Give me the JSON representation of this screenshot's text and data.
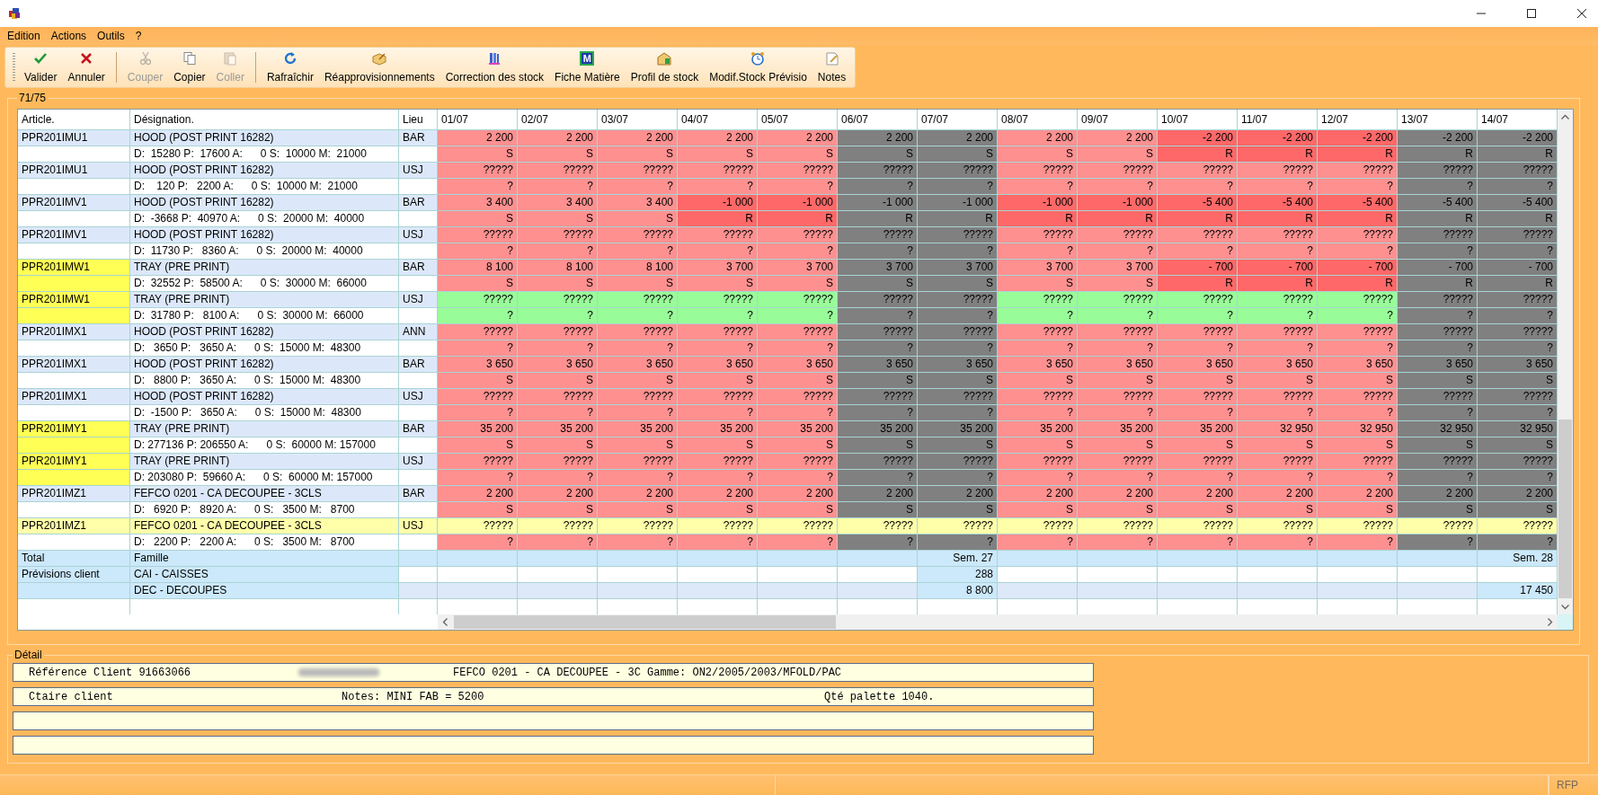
{
  "menu": [
    "Edition",
    "Actions",
    "Outils",
    "?"
  ],
  "toolbar": {
    "groups": [
      {
        "buttons": [
          {
            "label": "Valider",
            "disabled": false
          },
          {
            "label": "Annuler",
            "disabled": false
          }
        ]
      },
      {
        "buttons": [
          {
            "label": "Couper",
            "disabled": true
          },
          {
            "label": "Copier",
            "disabled": false
          },
          {
            "label": "Coller",
            "disabled": true
          }
        ]
      },
      {
        "buttons": [
          {
            "label": "Rafraîchir",
            "disabled": false
          },
          {
            "label": "Réapprovisionnements",
            "disabled": false
          },
          {
            "label": "Correction des stock",
            "disabled": false
          },
          {
            "label": "Fiche Matière",
            "disabled": false,
            "icon_text": "M"
          },
          {
            "label": "Profil de stock",
            "disabled": false
          },
          {
            "label": "Modif.Stock Prévisio",
            "disabled": false
          },
          {
            "label": "Notes",
            "disabled": false
          }
        ]
      }
    ]
  },
  "group_title": "71/75",
  "table": {
    "columns": [
      "Article.",
      "Désignation.",
      "Lieu",
      "01/07",
      "02/07",
      "03/07",
      "04/07",
      "05/07",
      "06/07",
      "07/07",
      "08/07",
      "09/07",
      "10/07",
      "11/07",
      "12/07",
      "13/07",
      "14/07"
    ],
    "rows": [
      {
        "article": "PPR201IMU1",
        "designation": "HOOD (POST PRINT 16282)",
        "lieu": "BAR",
        "flagged": false,
        "selected": false,
        "detail": "D:  15280 P:  17600 A:      0 S:  10000 M:  21000",
        "cells": [
          {
            "text": "2 200",
            "color": "#ff9090"
          },
          {
            "text": "2 200",
            "color": "#ff9090"
          },
          {
            "text": "2 200",
            "color": "#ff9090"
          },
          {
            "text": "2 200",
            "color": "#ff9090"
          },
          {
            "text": "2 200",
            "color": "#ff9090"
          },
          {
            "text": "2 200",
            "color": "#808080"
          },
          {
            "text": "2 200",
            "color": "#808080"
          },
          {
            "text": "2 200",
            "color": "#ff9090"
          },
          {
            "text": "2 200",
            "color": "#ff9090"
          },
          {
            "text": "-2 200",
            "color": "#ff6868"
          },
          {
            "text": "-2 200",
            "color": "#ff6868"
          },
          {
            "text": "-2 200",
            "color": "#ff6868"
          },
          {
            "text": "-2 200",
            "color": "#808080"
          },
          {
            "text": "-2 200",
            "color": "#808080"
          }
        ],
        "detail_cells": [
          {
            "text": "S",
            "color": "#ff9090"
          },
          {
            "text": "S",
            "color": "#ff9090"
          },
          {
            "text": "S",
            "color": "#ff9090"
          },
          {
            "text": "S",
            "color": "#ff9090"
          },
          {
            "text": "S",
            "color": "#ff9090"
          },
          {
            "text": "S",
            "color": "#808080"
          },
          {
            "text": "S",
            "color": "#808080"
          },
          {
            "text": "S",
            "color": "#ff9090"
          },
          {
            "text": "S",
            "color": "#ff9090"
          },
          {
            "text": "R",
            "color": "#ff6868"
          },
          {
            "text": "R",
            "color": "#ff6868"
          },
          {
            "text": "R",
            "color": "#ff6868"
          },
          {
            "text": "R",
            "color": "#808080"
          },
          {
            "text": "R",
            "color": "#808080"
          }
        ]
      },
      {
        "article": "PPR201IMU1",
        "designation": "HOOD (POST PRINT 16282)",
        "lieu": "USJ",
        "flagged": false,
        "selected": false,
        "detail": "D:    120 P:   2200 A:      0 S:  10000 M:  21000",
        "cells": [
          {
            "text": "?????",
            "color": "#ff9090"
          },
          {
            "text": "?????",
            "color": "#ff9090"
          },
          {
            "text": "?????",
            "color": "#ff9090"
          },
          {
            "text": "?????",
            "color": "#ff9090"
          },
          {
            "text": "?????",
            "color": "#ff9090"
          },
          {
            "text": "?????",
            "color": "#808080"
          },
          {
            "text": "?????",
            "color": "#808080"
          },
          {
            "text": "?????",
            "color": "#ff9090"
          },
          {
            "text": "?????",
            "color": "#ff9090"
          },
          {
            "text": "?????",
            "color": "#ff9090"
          },
          {
            "text": "?????",
            "color": "#ff9090"
          },
          {
            "text": "?????",
            "color": "#ff9090"
          },
          {
            "text": "?????",
            "color": "#808080"
          },
          {
            "text": "?????",
            "color": "#808080"
          }
        ],
        "detail_cells": [
          {
            "text": "?",
            "color": "#ff9090"
          },
          {
            "text": "?",
            "color": "#ff9090"
          },
          {
            "text": "?",
            "color": "#ff9090"
          },
          {
            "text": "?",
            "color": "#ff9090"
          },
          {
            "text": "?",
            "color": "#ff9090"
          },
          {
            "text": "?",
            "color": "#808080"
          },
          {
            "text": "?",
            "color": "#808080"
          },
          {
            "text": "?",
            "color": "#ff9090"
          },
          {
            "text": "?",
            "color": "#ff9090"
          },
          {
            "text": "?",
            "color": "#ff9090"
          },
          {
            "text": "?",
            "color": "#ff9090"
          },
          {
            "text": "?",
            "color": "#ff9090"
          },
          {
            "text": "?",
            "color": "#808080"
          },
          {
            "text": "?",
            "color": "#808080"
          }
        ]
      },
      {
        "article": "PPR201IMV1",
        "designation": "HOOD (POST PRINT 16282)",
        "lieu": "BAR",
        "flagged": false,
        "selected": false,
        "detail": "D:  -3668 P:  40970 A:      0 S:  20000 M:  40000",
        "cells": [
          {
            "text": "3 400",
            "color": "#ff9090"
          },
          {
            "text": "3 400",
            "color": "#ff9090"
          },
          {
            "text": "3 400",
            "color": "#ff9090"
          },
          {
            "text": "-1 000",
            "color": "#ff6868"
          },
          {
            "text": "-1 000",
            "color": "#ff6868"
          },
          {
            "text": "-1 000",
            "color": "#808080"
          },
          {
            "text": "-1 000",
            "color": "#808080"
          },
          {
            "text": "-1 000",
            "color": "#ff6868"
          },
          {
            "text": "-1 000",
            "color": "#ff6868"
          },
          {
            "text": "-5 400",
            "color": "#ff6868"
          },
          {
            "text": "-5 400",
            "color": "#ff6868"
          },
          {
            "text": "-5 400",
            "color": "#ff6868"
          },
          {
            "text": "-5 400",
            "color": "#808080"
          },
          {
            "text": "-5 400",
            "color": "#808080"
          }
        ],
        "detail_cells": [
          {
            "text": "S",
            "color": "#ff9090"
          },
          {
            "text": "S",
            "color": "#ff9090"
          },
          {
            "text": "S",
            "color": "#ff9090"
          },
          {
            "text": "R",
            "color": "#ff6868"
          },
          {
            "text": "R",
            "color": "#ff6868"
          },
          {
            "text": "R",
            "color": "#808080"
          },
          {
            "text": "R",
            "color": "#808080"
          },
          {
            "text": "R",
            "color": "#ff6868"
          },
          {
            "text": "R",
            "color": "#ff6868"
          },
          {
            "text": "R",
            "color": "#ff6868"
          },
          {
            "text": "R",
            "color": "#ff6868"
          },
          {
            "text": "R",
            "color": "#ff6868"
          },
          {
            "text": "R",
            "color": "#808080"
          },
          {
            "text": "R",
            "color": "#808080"
          }
        ]
      },
      {
        "article": "PPR201IMV1",
        "designation": "HOOD (POST PRINT 16282)",
        "lieu": "USJ",
        "flagged": false,
        "selected": false,
        "detail": "D:  11730 P:   8360 A:      0 S:  20000 M:  40000",
        "cells": [
          {
            "text": "?????",
            "color": "#ff9090"
          },
          {
            "text": "?????",
            "color": "#ff9090"
          },
          {
            "text": "?????",
            "color": "#ff9090"
          },
          {
            "text": "?????",
            "color": "#ff9090"
          },
          {
            "text": "?????",
            "color": "#ff9090"
          },
          {
            "text": "?????",
            "color": "#808080"
          },
          {
            "text": "?????",
            "color": "#808080"
          },
          {
            "text": "?????",
            "color": "#ff9090"
          },
          {
            "text": "?????",
            "color": "#ff9090"
          },
          {
            "text": "?????",
            "color": "#ff9090"
          },
          {
            "text": "?????",
            "color": "#ff9090"
          },
          {
            "text": "?????",
            "color": "#ff9090"
          },
          {
            "text": "?????",
            "color": "#808080"
          },
          {
            "text": "?????",
            "color": "#808080"
          }
        ],
        "detail_cells": [
          {
            "text": "?",
            "color": "#ff9090"
          },
          {
            "text": "?",
            "color": "#ff9090"
          },
          {
            "text": "?",
            "color": "#ff9090"
          },
          {
            "text": "?",
            "color": "#ff9090"
          },
          {
            "text": "?",
            "color": "#ff9090"
          },
          {
            "text": "?",
            "color": "#808080"
          },
          {
            "text": "?",
            "color": "#808080"
          },
          {
            "text": "?",
            "color": "#ff9090"
          },
          {
            "text": "?",
            "color": "#ff9090"
          },
          {
            "text": "?",
            "color": "#ff9090"
          },
          {
            "text": "?",
            "color": "#ff9090"
          },
          {
            "text": "?",
            "color": "#ff9090"
          },
          {
            "text": "?",
            "color": "#808080"
          },
          {
            "text": "?",
            "color": "#808080"
          }
        ]
      },
      {
        "article": "PPR201IMW1",
        "designation": "TRAY (PRE PRINT)",
        "lieu": "BAR",
        "flagged": true,
        "selected": false,
        "detail": "D:  32552 P:  58500 A:      0 S:  30000 M:  66000",
        "cells": [
          {
            "text": "8 100",
            "color": "#ff9090"
          },
          {
            "text": "8 100",
            "color": "#ff9090"
          },
          {
            "text": "8 100",
            "color": "#ff9090"
          },
          {
            "text": "3 700",
            "color": "#ff9090"
          },
          {
            "text": "3 700",
            "color": "#ff9090"
          },
          {
            "text": "3 700",
            "color": "#808080"
          },
          {
            "text": "3 700",
            "color": "#808080"
          },
          {
            "text": "3 700",
            "color": "#ff9090"
          },
          {
            "text": "3 700",
            "color": "#ff9090"
          },
          {
            "text": "- 700",
            "color": "#ff6868"
          },
          {
            "text": "- 700",
            "color": "#ff6868"
          },
          {
            "text": "- 700",
            "color": "#ff6868"
          },
          {
            "text": "- 700",
            "color": "#808080"
          },
          {
            "text": "- 700",
            "color": "#808080"
          }
        ],
        "detail_cells": [
          {
            "text": "S",
            "color": "#ff9090"
          },
          {
            "text": "S",
            "color": "#ff9090"
          },
          {
            "text": "S",
            "color": "#ff9090"
          },
          {
            "text": "S",
            "color": "#ff9090"
          },
          {
            "text": "S",
            "color": "#ff9090"
          },
          {
            "text": "S",
            "color": "#808080"
          },
          {
            "text": "S",
            "color": "#808080"
          },
          {
            "text": "S",
            "color": "#ff9090"
          },
          {
            "text": "S",
            "color": "#ff9090"
          },
          {
            "text": "R",
            "color": "#ff6868"
          },
          {
            "text": "R",
            "color": "#ff6868"
          },
          {
            "text": "R",
            "color": "#ff6868"
          },
          {
            "text": "R",
            "color": "#808080"
          },
          {
            "text": "R",
            "color": "#808080"
          }
        ]
      },
      {
        "article": "PPR201IMW1",
        "designation": "TRAY (PRE PRINT)",
        "lieu": "USJ",
        "flagged": true,
        "selected": false,
        "detail": "D:  31780 P:   8100 A:      0 S:  30000 M:  66000",
        "cells": [
          {
            "text": "?????",
            "color": "#98fc98"
          },
          {
            "text": "?????",
            "color": "#98fc98"
          },
          {
            "text": "?????",
            "color": "#98fc98"
          },
          {
            "text": "?????",
            "color": "#98fc98"
          },
          {
            "text": "?????",
            "color": "#98fc98"
          },
          {
            "text": "?????",
            "color": "#808080"
          },
          {
            "text": "?????",
            "color": "#808080"
          },
          {
            "text": "?????",
            "color": "#98fc98"
          },
          {
            "text": "?????",
            "color": "#98fc98"
          },
          {
            "text": "?????",
            "color": "#98fc98"
          },
          {
            "text": "?????",
            "color": "#98fc98"
          },
          {
            "text": "?????",
            "color": "#98fc98"
          },
          {
            "text": "?????",
            "color": "#808080"
          },
          {
            "text": "?????",
            "color": "#808080"
          }
        ],
        "detail_cells": [
          {
            "text": "?",
            "color": "#98fc98"
          },
          {
            "text": "?",
            "color": "#98fc98"
          },
          {
            "text": "?",
            "color": "#98fc98"
          },
          {
            "text": "?",
            "color": "#98fc98"
          },
          {
            "text": "?",
            "color": "#98fc98"
          },
          {
            "text": "?",
            "color": "#808080"
          },
          {
            "text": "?",
            "color": "#808080"
          },
          {
            "text": "?",
            "color": "#98fc98"
          },
          {
            "text": "?",
            "color": "#98fc98"
          },
          {
            "text": "?",
            "color": "#98fc98"
          },
          {
            "text": "?",
            "color": "#98fc98"
          },
          {
            "text": "?",
            "color": "#98fc98"
          },
          {
            "text": "?",
            "color": "#808080"
          },
          {
            "text": "?",
            "color": "#808080"
          }
        ]
      },
      {
        "article": "PPR201IMX1",
        "designation": "HOOD (POST PRINT 16282)",
        "lieu": "ANN",
        "flagged": false,
        "selected": false,
        "detail": "D:   3650 P:   3650 A:      0 S:  15000 M:  48300",
        "cells": [
          {
            "text": "?????",
            "color": "#ff9090"
          },
          {
            "text": "?????",
            "color": "#ff9090"
          },
          {
            "text": "?????",
            "color": "#ff9090"
          },
          {
            "text": "?????",
            "color": "#ff9090"
          },
          {
            "text": "?????",
            "color": "#ff9090"
          },
          {
            "text": "?????",
            "color": "#808080"
          },
          {
            "text": "?????",
            "color": "#808080"
          },
          {
            "text": "?????",
            "color": "#ff9090"
          },
          {
            "text": "?????",
            "color": "#ff9090"
          },
          {
            "text": "?????",
            "color": "#ff9090"
          },
          {
            "text": "?????",
            "color": "#ff9090"
          },
          {
            "text": "?????",
            "color": "#ff9090"
          },
          {
            "text": "?????",
            "color": "#808080"
          },
          {
            "text": "?????",
            "color": "#808080"
          }
        ],
        "detail_cells": [
          {
            "text": "?",
            "color": "#ff9090"
          },
          {
            "text": "?",
            "color": "#ff9090"
          },
          {
            "text": "?",
            "color": "#ff9090"
          },
          {
            "text": "?",
            "color": "#ff9090"
          },
          {
            "text": "?",
            "color": "#ff9090"
          },
          {
            "text": "?",
            "color": "#808080"
          },
          {
            "text": "?",
            "color": "#808080"
          },
          {
            "text": "?",
            "color": "#ff9090"
          },
          {
            "text": "?",
            "color": "#ff9090"
          },
          {
            "text": "?",
            "color": "#ff9090"
          },
          {
            "text": "?",
            "color": "#ff9090"
          },
          {
            "text": "?",
            "color": "#ff9090"
          },
          {
            "text": "?",
            "color": "#808080"
          },
          {
            "text": "?",
            "color": "#808080"
          }
        ]
      },
      {
        "article": "PPR201IMX1",
        "designation": "HOOD (POST PRINT 16282)",
        "lieu": "BAR",
        "flagged": false,
        "selected": false,
        "detail": "D:   8800 P:   3650 A:      0 S:  15000 M:  48300",
        "cells": [
          {
            "text": "3 650",
            "color": "#ff9090"
          },
          {
            "text": "3 650",
            "color": "#ff9090"
          },
          {
            "text": "3 650",
            "color": "#ff9090"
          },
          {
            "text": "3 650",
            "color": "#ff9090"
          },
          {
            "text": "3 650",
            "color": "#ff9090"
          },
          {
            "text": "3 650",
            "color": "#808080"
          },
          {
            "text": "3 650",
            "color": "#808080"
          },
          {
            "text": "3 650",
            "color": "#ff9090"
          },
          {
            "text": "3 650",
            "color": "#ff9090"
          },
          {
            "text": "3 650",
            "color": "#ff9090"
          },
          {
            "text": "3 650",
            "color": "#ff9090"
          },
          {
            "text": "3 650",
            "color": "#ff9090"
          },
          {
            "text": "3 650",
            "color": "#808080"
          },
          {
            "text": "3 650",
            "color": "#808080"
          }
        ],
        "detail_cells": [
          {
            "text": "S",
            "color": "#ff9090"
          },
          {
            "text": "S",
            "color": "#ff9090"
          },
          {
            "text": "S",
            "color": "#ff9090"
          },
          {
            "text": "S",
            "color": "#ff9090"
          },
          {
            "text": "S",
            "color": "#ff9090"
          },
          {
            "text": "S",
            "color": "#808080"
          },
          {
            "text": "S",
            "color": "#808080"
          },
          {
            "text": "S",
            "color": "#ff9090"
          },
          {
            "text": "S",
            "color": "#ff9090"
          },
          {
            "text": "S",
            "color": "#ff9090"
          },
          {
            "text": "S",
            "color": "#ff9090"
          },
          {
            "text": "S",
            "color": "#ff9090"
          },
          {
            "text": "S",
            "color": "#808080"
          },
          {
            "text": "S",
            "color": "#808080"
          }
        ]
      },
      {
        "article": "PPR201IMX1",
        "designation": "HOOD (POST PRINT 16282)",
        "lieu": "USJ",
        "flagged": false,
        "selected": false,
        "detail": "D:  -1500 P:   3650 A:      0 S:  15000 M:  48300",
        "cells": [
          {
            "text": "?????",
            "color": "#ff9090"
          },
          {
            "text": "?????",
            "color": "#ff9090"
          },
          {
            "text": "?????",
            "color": "#ff9090"
          },
          {
            "text": "?????",
            "color": "#ff9090"
          },
          {
            "text": "?????",
            "color": "#ff9090"
          },
          {
            "text": "?????",
            "color": "#808080"
          },
          {
            "text": "?????",
            "color": "#808080"
          },
          {
            "text": "?????",
            "color": "#ff9090"
          },
          {
            "text": "?????",
            "color": "#ff9090"
          },
          {
            "text": "?????",
            "color": "#ff9090"
          },
          {
            "text": "?????",
            "color": "#ff9090"
          },
          {
            "text": "?????",
            "color": "#ff9090"
          },
          {
            "text": "?????",
            "color": "#808080"
          },
          {
            "text": "?????",
            "color": "#808080"
          }
        ],
        "detail_cells": [
          {
            "text": "?",
            "color": "#ff9090"
          },
          {
            "text": "?",
            "color": "#ff9090"
          },
          {
            "text": "?",
            "color": "#ff9090"
          },
          {
            "text": "?",
            "color": "#ff9090"
          },
          {
            "text": "?",
            "color": "#ff9090"
          },
          {
            "text": "?",
            "color": "#808080"
          },
          {
            "text": "?",
            "color": "#808080"
          },
          {
            "text": "?",
            "color": "#ff9090"
          },
          {
            "text": "?",
            "color": "#ff9090"
          },
          {
            "text": "?",
            "color": "#ff9090"
          },
          {
            "text": "?",
            "color": "#ff9090"
          },
          {
            "text": "?",
            "color": "#ff9090"
          },
          {
            "text": "?",
            "color": "#808080"
          },
          {
            "text": "?",
            "color": "#808080"
          }
        ]
      },
      {
        "article": "PPR201IMY1",
        "designation": "TRAY (PRE PRINT)",
        "lieu": "BAR",
        "flagged": true,
        "selected": false,
        "detail": "D: 277136 P: 206550 A:      0 S:  60000 M: 157000",
        "cells": [
          {
            "text": "35 200",
            "color": "#ff9090"
          },
          {
            "text": "35 200",
            "color": "#ff9090"
          },
          {
            "text": "35 200",
            "color": "#ff9090"
          },
          {
            "text": "35 200",
            "color": "#ff9090"
          },
          {
            "text": "35 200",
            "color": "#ff9090"
          },
          {
            "text": "35 200",
            "color": "#808080"
          },
          {
            "text": "35 200",
            "color": "#808080"
          },
          {
            "text": "35 200",
            "color": "#ff9090"
          },
          {
            "text": "35 200",
            "color": "#ff9090"
          },
          {
            "text": "35 200",
            "color": "#ff9090"
          },
          {
            "text": "32 950",
            "color": "#ff9090"
          },
          {
            "text": "32 950",
            "color": "#ff9090"
          },
          {
            "text": "32 950",
            "color": "#808080"
          },
          {
            "text": "32 950",
            "color": "#808080"
          }
        ],
        "detail_cells": [
          {
            "text": "S",
            "color": "#ff9090"
          },
          {
            "text": "S",
            "color": "#ff9090"
          },
          {
            "text": "S",
            "color": "#ff9090"
          },
          {
            "text": "S",
            "color": "#ff9090"
          },
          {
            "text": "S",
            "color": "#ff9090"
          },
          {
            "text": "S",
            "color": "#808080"
          },
          {
            "text": "S",
            "color": "#808080"
          },
          {
            "text": "S",
            "color": "#ff9090"
          },
          {
            "text": "S",
            "color": "#ff9090"
          },
          {
            "text": "S",
            "color": "#ff9090"
          },
          {
            "text": "S",
            "color": "#ff9090"
          },
          {
            "text": "S",
            "color": "#ff9090"
          },
          {
            "text": "S",
            "color": "#808080"
          },
          {
            "text": "S",
            "color": "#808080"
          }
        ]
      },
      {
        "article": "PPR201IMY1",
        "designation": "TRAY (PRE PRINT)",
        "lieu": "USJ",
        "flagged": true,
        "selected": false,
        "detail": "D: 203080 P:  59660 A:      0 S:  60000 M: 157000",
        "cells": [
          {
            "text": "?????",
            "color": "#ff9090"
          },
          {
            "text": "?????",
            "color": "#ff9090"
          },
          {
            "text": "?????",
            "color": "#ff9090"
          },
          {
            "text": "?????",
            "color": "#ff9090"
          },
          {
            "text": "?????",
            "color": "#ff9090"
          },
          {
            "text": "?????",
            "color": "#808080"
          },
          {
            "text": "?????",
            "color": "#808080"
          },
          {
            "text": "?????",
            "color": "#ff9090"
          },
          {
            "text": "?????",
            "color": "#ff9090"
          },
          {
            "text": "?????",
            "color": "#ff9090"
          },
          {
            "text": "?????",
            "color": "#ff9090"
          },
          {
            "text": "?????",
            "color": "#ff9090"
          },
          {
            "text": "?????",
            "color": "#808080"
          },
          {
            "text": "?????",
            "color": "#808080"
          }
        ],
        "detail_cells": [
          {
            "text": "?",
            "color": "#ff9090"
          },
          {
            "text": "?",
            "color": "#ff9090"
          },
          {
            "text": "?",
            "color": "#ff9090"
          },
          {
            "text": "?",
            "color": "#ff9090"
          },
          {
            "text": "?",
            "color": "#ff9090"
          },
          {
            "text": "?",
            "color": "#808080"
          },
          {
            "text": "?",
            "color": "#808080"
          },
          {
            "text": "?",
            "color": "#ff9090"
          },
          {
            "text": "?",
            "color": "#ff9090"
          },
          {
            "text": "?",
            "color": "#ff9090"
          },
          {
            "text": "?",
            "color": "#ff9090"
          },
          {
            "text": "?",
            "color": "#ff9090"
          },
          {
            "text": "?",
            "color": "#808080"
          },
          {
            "text": "?",
            "color": "#808080"
          }
        ]
      },
      {
        "article": "PPR201IMZ1",
        "designation": "FEFCO 0201 - CA DECOUPEE - 3CLS",
        "lieu": "BAR",
        "flagged": false,
        "selected": false,
        "detail": "D:   6920 P:   8920 A:      0 S:   3500 M:   8700",
        "cells": [
          {
            "text": "2 200",
            "color": "#ff9090"
          },
          {
            "text": "2 200",
            "color": "#ff9090"
          },
          {
            "text": "2 200",
            "color": "#ff9090"
          },
          {
            "text": "2 200",
            "color": "#ff9090"
          },
          {
            "text": "2 200",
            "color": "#ff9090"
          },
          {
            "text": "2 200",
            "color": "#808080"
          },
          {
            "text": "2 200",
            "color": "#808080"
          },
          {
            "text": "2 200",
            "color": "#ff9090"
          },
          {
            "text": "2 200",
            "color": "#ff9090"
          },
          {
            "text": "2 200",
            "color": "#ff9090"
          },
          {
            "text": "2 200",
            "color": "#ff9090"
          },
          {
            "text": "2 200",
            "color": "#ff9090"
          },
          {
            "text": "2 200",
            "color": "#808080"
          },
          {
            "text": "2 200",
            "color": "#808080"
          }
        ],
        "detail_cells": [
          {
            "text": "S",
            "color": "#ff9090"
          },
          {
            "text": "S",
            "color": "#ff9090"
          },
          {
            "text": "S",
            "color": "#ff9090"
          },
          {
            "text": "S",
            "color": "#ff9090"
          },
          {
            "text": "S",
            "color": "#ff9090"
          },
          {
            "text": "S",
            "color": "#808080"
          },
          {
            "text": "S",
            "color": "#808080"
          },
          {
            "text": "S",
            "color": "#ff9090"
          },
          {
            "text": "S",
            "color": "#ff9090"
          },
          {
            "text": "S",
            "color": "#ff9090"
          },
          {
            "text": "S",
            "color": "#ff9090"
          },
          {
            "text": "S",
            "color": "#ff9090"
          },
          {
            "text": "S",
            "color": "#808080"
          },
          {
            "text": "S",
            "color": "#808080"
          }
        ]
      },
      {
        "article": "PPR201IMZ1",
        "designation": "FEFCO 0201 - CA DECOUPEE - 3CLS",
        "lieu": "USJ",
        "flagged": false,
        "selected": true,
        "detail": "D:   2200 P:   2200 A:      0 S:   3500 M:   8700",
        "cells": [
          {
            "text": "?????",
            "color": "#ffffaa"
          },
          {
            "text": "?????",
            "color": "#ffffaa"
          },
          {
            "text": "?????",
            "color": "#ffffaa"
          },
          {
            "text": "?????",
            "color": "#ffffaa"
          },
          {
            "text": "?????",
            "color": "#ffffaa"
          },
          {
            "text": "?????",
            "color": "#ffffaa"
          },
          {
            "text": "?????",
            "color": "#ffffaa"
          },
          {
            "text": "?????",
            "color": "#ffffaa"
          },
          {
            "text": "?????",
            "color": "#ffffaa"
          },
          {
            "text": "?????",
            "color": "#ffffaa"
          },
          {
            "text": "?????",
            "color": "#ffffaa"
          },
          {
            "text": "?????",
            "color": "#ffffaa"
          },
          {
            "text": "?????",
            "color": "#ffffaa"
          },
          {
            "text": "?????",
            "color": "#ffffaa"
          }
        ],
        "detail_cells": [
          {
            "text": "?",
            "color": "#ff9090"
          },
          {
            "text": "?",
            "color": "#ff9090"
          },
          {
            "text": "?",
            "color": "#ff9090"
          },
          {
            "text": "?",
            "color": "#ff9090"
          },
          {
            "text": "?",
            "color": "#ff9090"
          },
          {
            "text": "?",
            "color": "#808080"
          },
          {
            "text": "?",
            "color": "#808080"
          },
          {
            "text": "?",
            "color": "#ff9090"
          },
          {
            "text": "?",
            "color": "#ff9090"
          },
          {
            "text": "?",
            "color": "#ff9090"
          },
          {
            "text": "?",
            "color": "#ff9090"
          },
          {
            "text": "?",
            "color": "#ff9090"
          },
          {
            "text": "?",
            "color": "#808080"
          },
          {
            "text": "?",
            "color": "#808080"
          }
        ]
      }
    ],
    "totals": [
      {
        "label": "Total",
        "designation": "Famille",
        "kind": "band",
        "cells": [
          null,
          null,
          null,
          null,
          null,
          null,
          "Sem. 27",
          null,
          null,
          null,
          null,
          null,
          null,
          "Sem. 28"
        ]
      },
      {
        "label": "Prévisions client",
        "designation": "CAI - CAISSES",
        "kind": "plain",
        "cells": [
          null,
          null,
          null,
          null,
          null,
          null,
          "288",
          null,
          null,
          null,
          null,
          null,
          null,
          null
        ]
      },
      {
        "designation": "DEC - DECOUPES",
        "kind": "pale",
        "cells": [
          null,
          null,
          null,
          null,
          null,
          null,
          "8 800",
          null,
          null,
          null,
          null,
          null,
          null,
          "17 450"
        ]
      }
    ]
  },
  "detail": {
    "title": "Détail",
    "fields": [
      {
        "kind": "filled",
        "parts": [
          {
            "kind": "text",
            "text": "Référence Client 91663066"
          },
          {
            "kind": "blurred"
          },
          {
            "kind": "text",
            "text": "FEFCO 0201 - CA DECOUPEE - 3C Gamme: ON2/2005/2003/MFOLD/PAC"
          }
        ]
      },
      {
        "kind": "filled",
        "parts": [
          {
            "kind": "text",
            "text": "Ctaire client"
          },
          {
            "kind": "text",
            "text": "Notes: MINI FAB = 5200"
          },
          {
            "kind": "text",
            "text": "Qté palette 1040."
          }
        ]
      },
      {
        "kind": "blank"
      },
      {
        "kind": "blank"
      }
    ]
  },
  "status_bar": {
    "text": "RFP"
  }
}
